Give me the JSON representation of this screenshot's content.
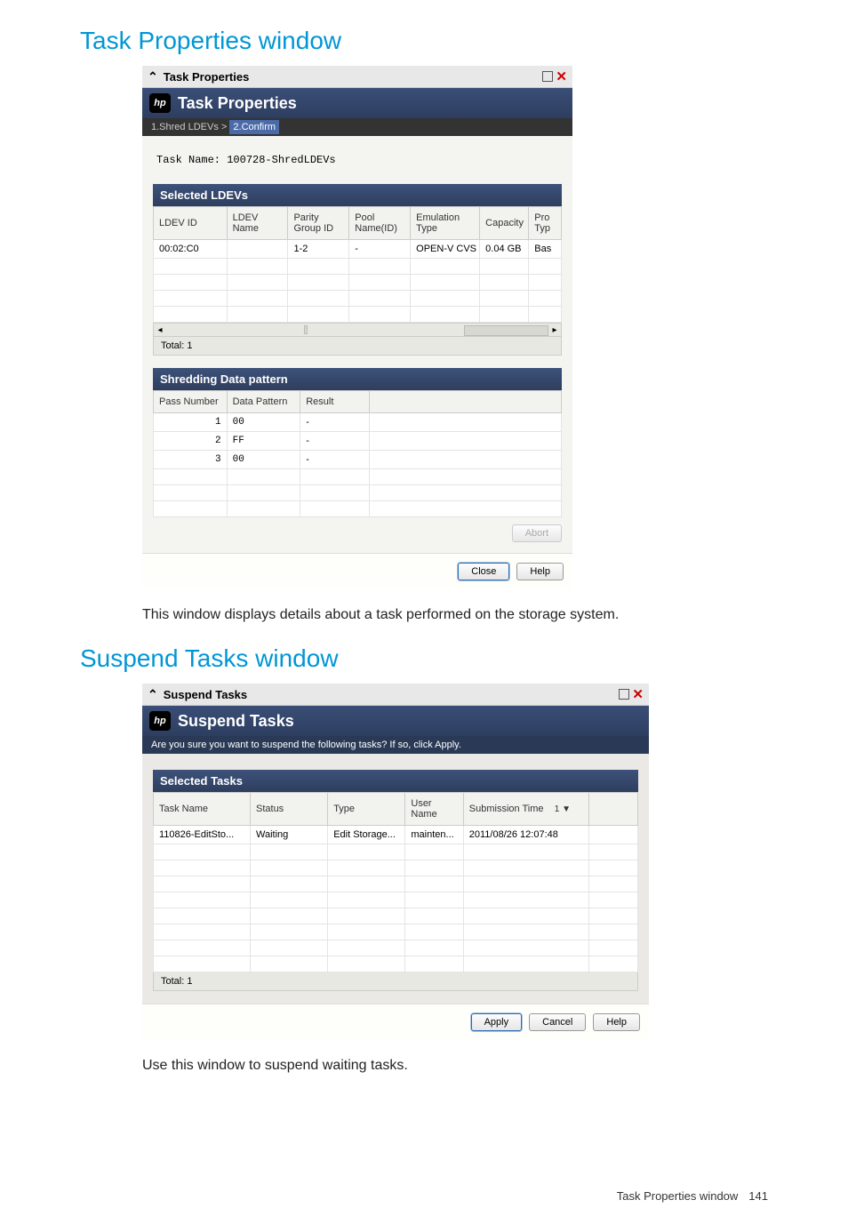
{
  "headings": {
    "h1a": "Task Properties window",
    "h1b": "Suspend Tasks window"
  },
  "descriptions": {
    "d1": "This window displays details about a task performed on the storage system.",
    "d2": "Use this window to suspend waiting tasks."
  },
  "taskProps": {
    "titlebar": "Task Properties",
    "banner": "Task Properties",
    "breadcrumb": {
      "step1": "1.Shred LDEVs",
      "arrow": ">",
      "step2": "2.Confirm"
    },
    "taskNameLabel": "Task Name: 100728-ShredLDEVs",
    "ldevs": {
      "sectionTitle": "Selected LDEVs",
      "headers": [
        "LDEV ID",
        "LDEV Name",
        "Parity Group ID",
        "Pool Name(ID)",
        "Emulation Type",
        "Capacity",
        "Pro Typ"
      ],
      "row": [
        "00:02:C0",
        "",
        "1-2",
        "-",
        "OPEN-V CVS",
        "0.04 GB",
        "Bas"
      ],
      "total": "Total: 1"
    },
    "pattern": {
      "sectionTitle": "Shredding Data pattern",
      "headers": [
        "Pass Number",
        "Data Pattern",
        "Result"
      ],
      "rows": [
        [
          "1",
          "00",
          "-"
        ],
        [
          "2",
          "FF",
          "-"
        ],
        [
          "3",
          "00",
          "-"
        ]
      ]
    },
    "buttons": {
      "abort": "Abort",
      "close": "Close",
      "help": "Help"
    }
  },
  "suspend": {
    "titlebar": "Suspend Tasks",
    "banner": "Suspend Tasks",
    "confirmText": "Are you sure you want to suspend the following tasks? If so, click Apply.",
    "tasks": {
      "sectionTitle": "Selected Tasks",
      "headers": [
        "Task Name",
        "Status",
        "Type",
        "User Name",
        "Submission Time"
      ],
      "sortIndicator": "1 ▼",
      "row": [
        "110826-EditSto...",
        "Waiting",
        "Edit Storage...",
        "mainten...",
        "2011/08/26 12:07:48"
      ],
      "total": "Total: 1"
    },
    "buttons": {
      "apply": "Apply",
      "cancel": "Cancel",
      "help": "Help"
    }
  },
  "footer": {
    "label": "Task Properties window",
    "page": "141"
  }
}
